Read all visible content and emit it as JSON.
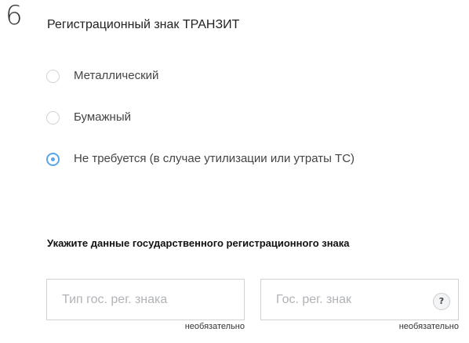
{
  "step": {
    "number": "6",
    "title": "Регистрационный знак ТРАНЗИТ"
  },
  "plate_type": {
    "options": [
      {
        "label": "Металлический",
        "selected": false
      },
      {
        "label": "Бумажный",
        "selected": false
      },
      {
        "label": "Не требуется (в случае утилизации или утраты ТС)",
        "selected": true
      }
    ]
  },
  "plate_details": {
    "heading": "Укажите данные государственного регистрационного знака",
    "type_field": {
      "value": "",
      "placeholder": "Тип гос. рег. знака",
      "note": "необязательно"
    },
    "number_field": {
      "value": "",
      "placeholder": "Гос. рег. знак",
      "note": "необязательно",
      "help_symbol": "?"
    }
  },
  "colors": {
    "accent": "#5aa6e8",
    "border": "#d0d3d6",
    "placeholder": "#b0b3b7"
  }
}
